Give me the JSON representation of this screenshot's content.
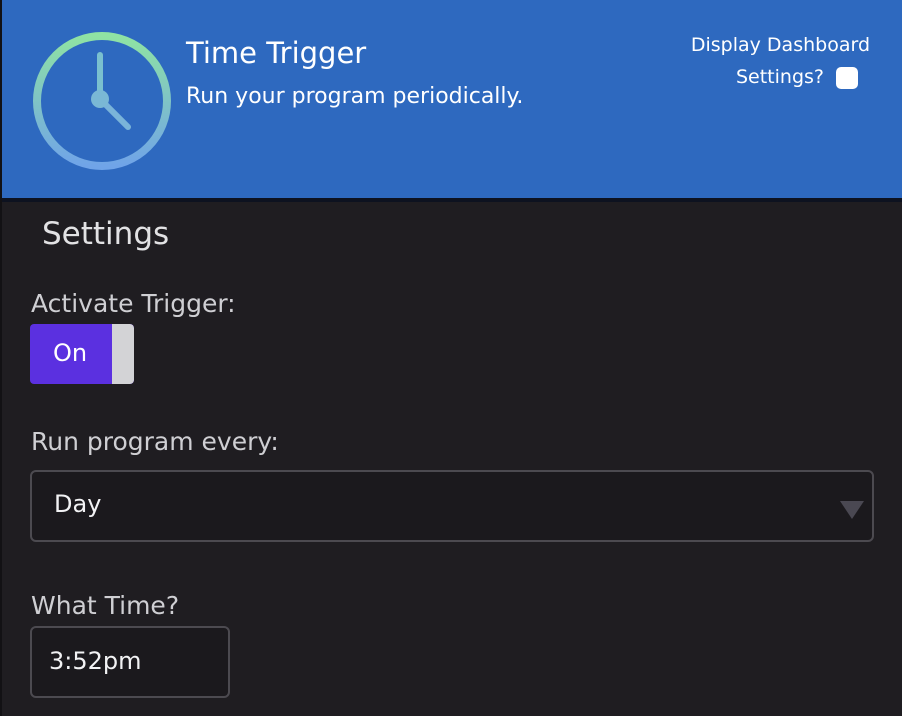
{
  "header": {
    "title": "Time Trigger",
    "subtitle": "Run your program periodically.",
    "icon": "clock-icon",
    "dashboard_toggle": {
      "line1": "Display Dashboard",
      "line2": "Settings?",
      "checked": false
    }
  },
  "settings": {
    "title": "Settings",
    "activate_trigger": {
      "label": "Activate Trigger:",
      "toggle_label": "On",
      "state": true
    },
    "run_program_every": {
      "label": "Run program every:",
      "selected": "Day"
    },
    "what_time": {
      "label": "What Time?",
      "value": "3:52pm"
    }
  },
  "colors": {
    "header_bg": "#2e69bf",
    "page_bg": "#1f1d21",
    "toggle_on": "#5b30e0",
    "clock_gradient_start": "#8fe3a3",
    "clock_gradient_end": "#70a4e8"
  }
}
